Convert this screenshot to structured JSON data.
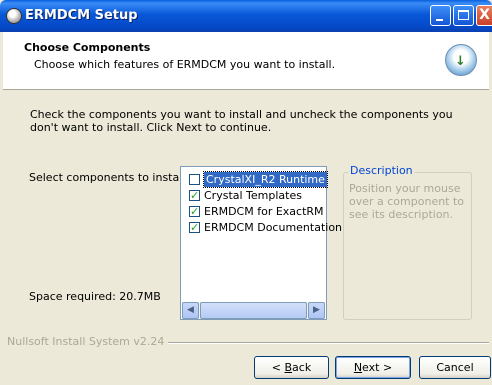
{
  "window": {
    "title": "ERMDCM Setup",
    "close_glyph": "X"
  },
  "header": {
    "title": "Choose Components",
    "subtitle": "Choose which features of ERMDCM you want to install."
  },
  "intro": "Check the components you want to install and uncheck the components you don't want to install. Click Next to continue.",
  "select_label": "Select components to install:",
  "components": [
    {
      "label": "CrystalXI_R2 Runtime",
      "checked": false,
      "selected": true
    },
    {
      "label": "Crystal Templates",
      "checked": true,
      "selected": false
    },
    {
      "label": "ERMDCM for ExactRM",
      "checked": true,
      "selected": false
    },
    {
      "label": "ERMDCM Documentation",
      "checked": true,
      "selected": false
    }
  ],
  "description": {
    "title": "Description",
    "text": "Position your mouse over a component to see its description."
  },
  "space_required": "Space required: 20.7MB",
  "branding": "Nullsoft Install System v2.24",
  "buttons": {
    "back_prefix": "< ",
    "back_key": "B",
    "back_rest": "ack",
    "next_key": "N",
    "next_rest": "ext >",
    "cancel": "Cancel"
  }
}
